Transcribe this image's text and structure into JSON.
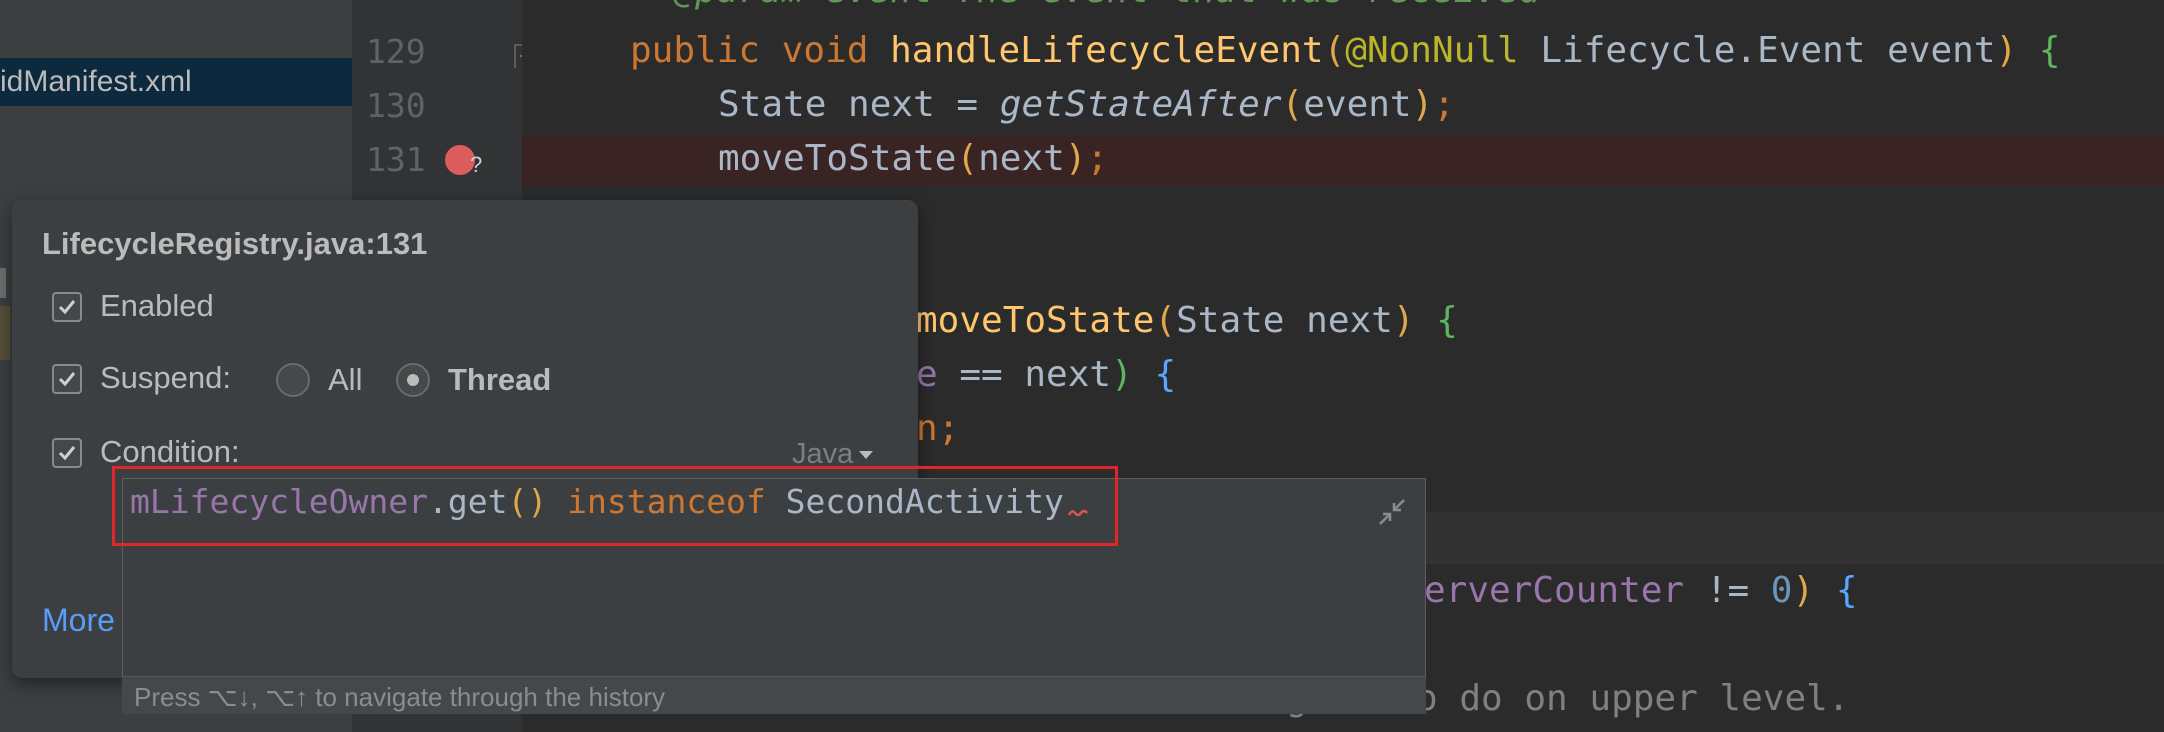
{
  "project_tree": {
    "manifest_item": "idManifest.xml"
  },
  "gutter": {
    "line_numbers": [
      "129",
      "130",
      "131"
    ],
    "breakpoint_badge": "?"
  },
  "editor": {
    "line129": {
      "kw": "public void ",
      "fn": "handleLifecycleEvent",
      "open": "(",
      "ann": "@NonNull ",
      "type": "Lifecycle.Event event",
      "close": ")",
      "brace": " {"
    },
    "line130": {
      "pre": "State next = ",
      "call": "getStateAfter",
      "open": "(",
      "arg": "event",
      "close": ")",
      "semi": ";"
    },
    "line131": {
      "call": "moveToState",
      "open": "(",
      "arg": "next",
      "close": ")",
      "semi": ";"
    },
    "line_a": {
      "fn": "moveToState",
      "open": "(",
      "args": "State next",
      "close": ")",
      "brace": " {"
    },
    "line_b": {
      "fld": "e",
      "rest": " == next",
      "close": ")",
      "brace": " {"
    },
    "line_c": {
      "kw": "n",
      "semi": ";"
    },
    "line_d": {
      "fld": "erverCounter",
      "op": " != ",
      "num": "0",
      "close": ")",
      "brace": " {"
    },
    "line_e": {
      "text": "o do on upper level."
    },
    "line_e_prefix": "g",
    "top_comment": "* @param event The event that was received"
  },
  "breakpoint_popup": {
    "title": "LifecycleRegistry.java:131",
    "enabled_label": "Enabled",
    "suspend_label": "Suspend:",
    "suspend_options": [
      "All",
      "Thread"
    ],
    "suspend_selected": "Thread",
    "condition_label": "Condition:",
    "language": "Java",
    "more_link": "More",
    "enabled_checked": true,
    "suspend_checked": true,
    "condition_checked": true
  },
  "condition_editor": {
    "field": "mLifecycleOwner",
    "dot_call": ".get",
    "open": "(",
    "close": ")",
    "keyword": " instanceof ",
    "type": "SecondActivity",
    "hint": "Press ⌥↓, ⌥↑ to navigate through the history"
  },
  "colors": {
    "breakpoint": "#db5c5c",
    "highlight_box": "#e0262b",
    "keyword": "#cc7832",
    "function": "#ffc66d",
    "field": "#9876aa",
    "link": "#589df6"
  }
}
